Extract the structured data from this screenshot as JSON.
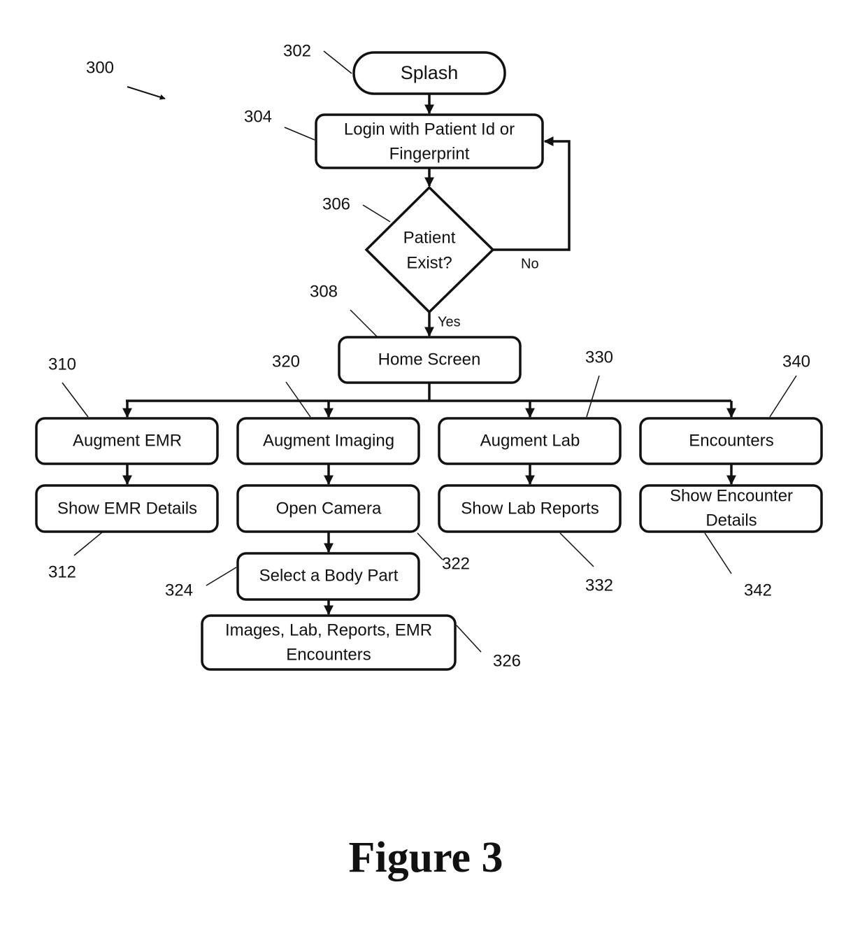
{
  "figure": {
    "caption": "Figure 3",
    "reference": "300"
  },
  "nodes": {
    "splash": {
      "ref": "302",
      "lines": [
        "Splash"
      ],
      "shape": "terminal"
    },
    "login": {
      "ref": "304",
      "lines": [
        "Login with Patient Id or",
        "Fingerprint"
      ],
      "shape": "process"
    },
    "patient_exist": {
      "ref": "306",
      "lines": [
        "Patient",
        "Exist?"
      ],
      "shape": "decision"
    },
    "home_screen": {
      "ref": "308",
      "lines": [
        "Home Screen"
      ],
      "shape": "process"
    },
    "augment_emr": {
      "ref": "310",
      "lines": [
        "Augment EMR"
      ],
      "shape": "process"
    },
    "show_emr_details": {
      "ref": "312",
      "lines": [
        "Show EMR Details"
      ],
      "shape": "process"
    },
    "augment_imaging": {
      "ref": "320",
      "lines": [
        "Augment Imaging"
      ],
      "shape": "process"
    },
    "open_camera": {
      "ref": "322",
      "lines": [
        "Open Camera"
      ],
      "shape": "process"
    },
    "select_body_part": {
      "ref": "324",
      "lines": [
        "Select a Body Part"
      ],
      "shape": "process"
    },
    "images_lab_reports": {
      "ref": "326",
      "lines": [
        "Images, Lab, Reports, EMR",
        "Encounters"
      ],
      "shape": "process"
    },
    "augment_lab": {
      "ref": "330",
      "lines": [
        "Augment Lab"
      ],
      "shape": "process"
    },
    "show_lab_reports": {
      "ref": "332",
      "lines": [
        "Show Lab Reports"
      ],
      "shape": "process"
    },
    "encounters": {
      "ref": "340",
      "lines": [
        "Encounters"
      ],
      "shape": "process"
    },
    "show_encounter_details": {
      "ref": "342",
      "lines": [
        "Show Encounter",
        "Details"
      ],
      "shape": "process"
    }
  },
  "edges": [
    {
      "from": "splash",
      "to": "login",
      "label": ""
    },
    {
      "from": "login",
      "to": "patient_exist",
      "label": ""
    },
    {
      "from": "patient_exist",
      "to": "login",
      "label": "No"
    },
    {
      "from": "patient_exist",
      "to": "home_screen",
      "label": "Yes"
    },
    {
      "from": "home_screen",
      "to": "augment_emr",
      "label": ""
    },
    {
      "from": "home_screen",
      "to": "augment_imaging",
      "label": ""
    },
    {
      "from": "home_screen",
      "to": "augment_lab",
      "label": ""
    },
    {
      "from": "home_screen",
      "to": "encounters",
      "label": ""
    },
    {
      "from": "augment_emr",
      "to": "show_emr_details",
      "label": ""
    },
    {
      "from": "augment_imaging",
      "to": "open_camera",
      "label": ""
    },
    {
      "from": "open_camera",
      "to": "select_body_part",
      "label": ""
    },
    {
      "from": "select_body_part",
      "to": "images_lab_reports",
      "label": ""
    },
    {
      "from": "augment_lab",
      "to": "show_lab_reports",
      "label": ""
    },
    {
      "from": "encounters",
      "to": "show_encounter_details",
      "label": ""
    }
  ]
}
